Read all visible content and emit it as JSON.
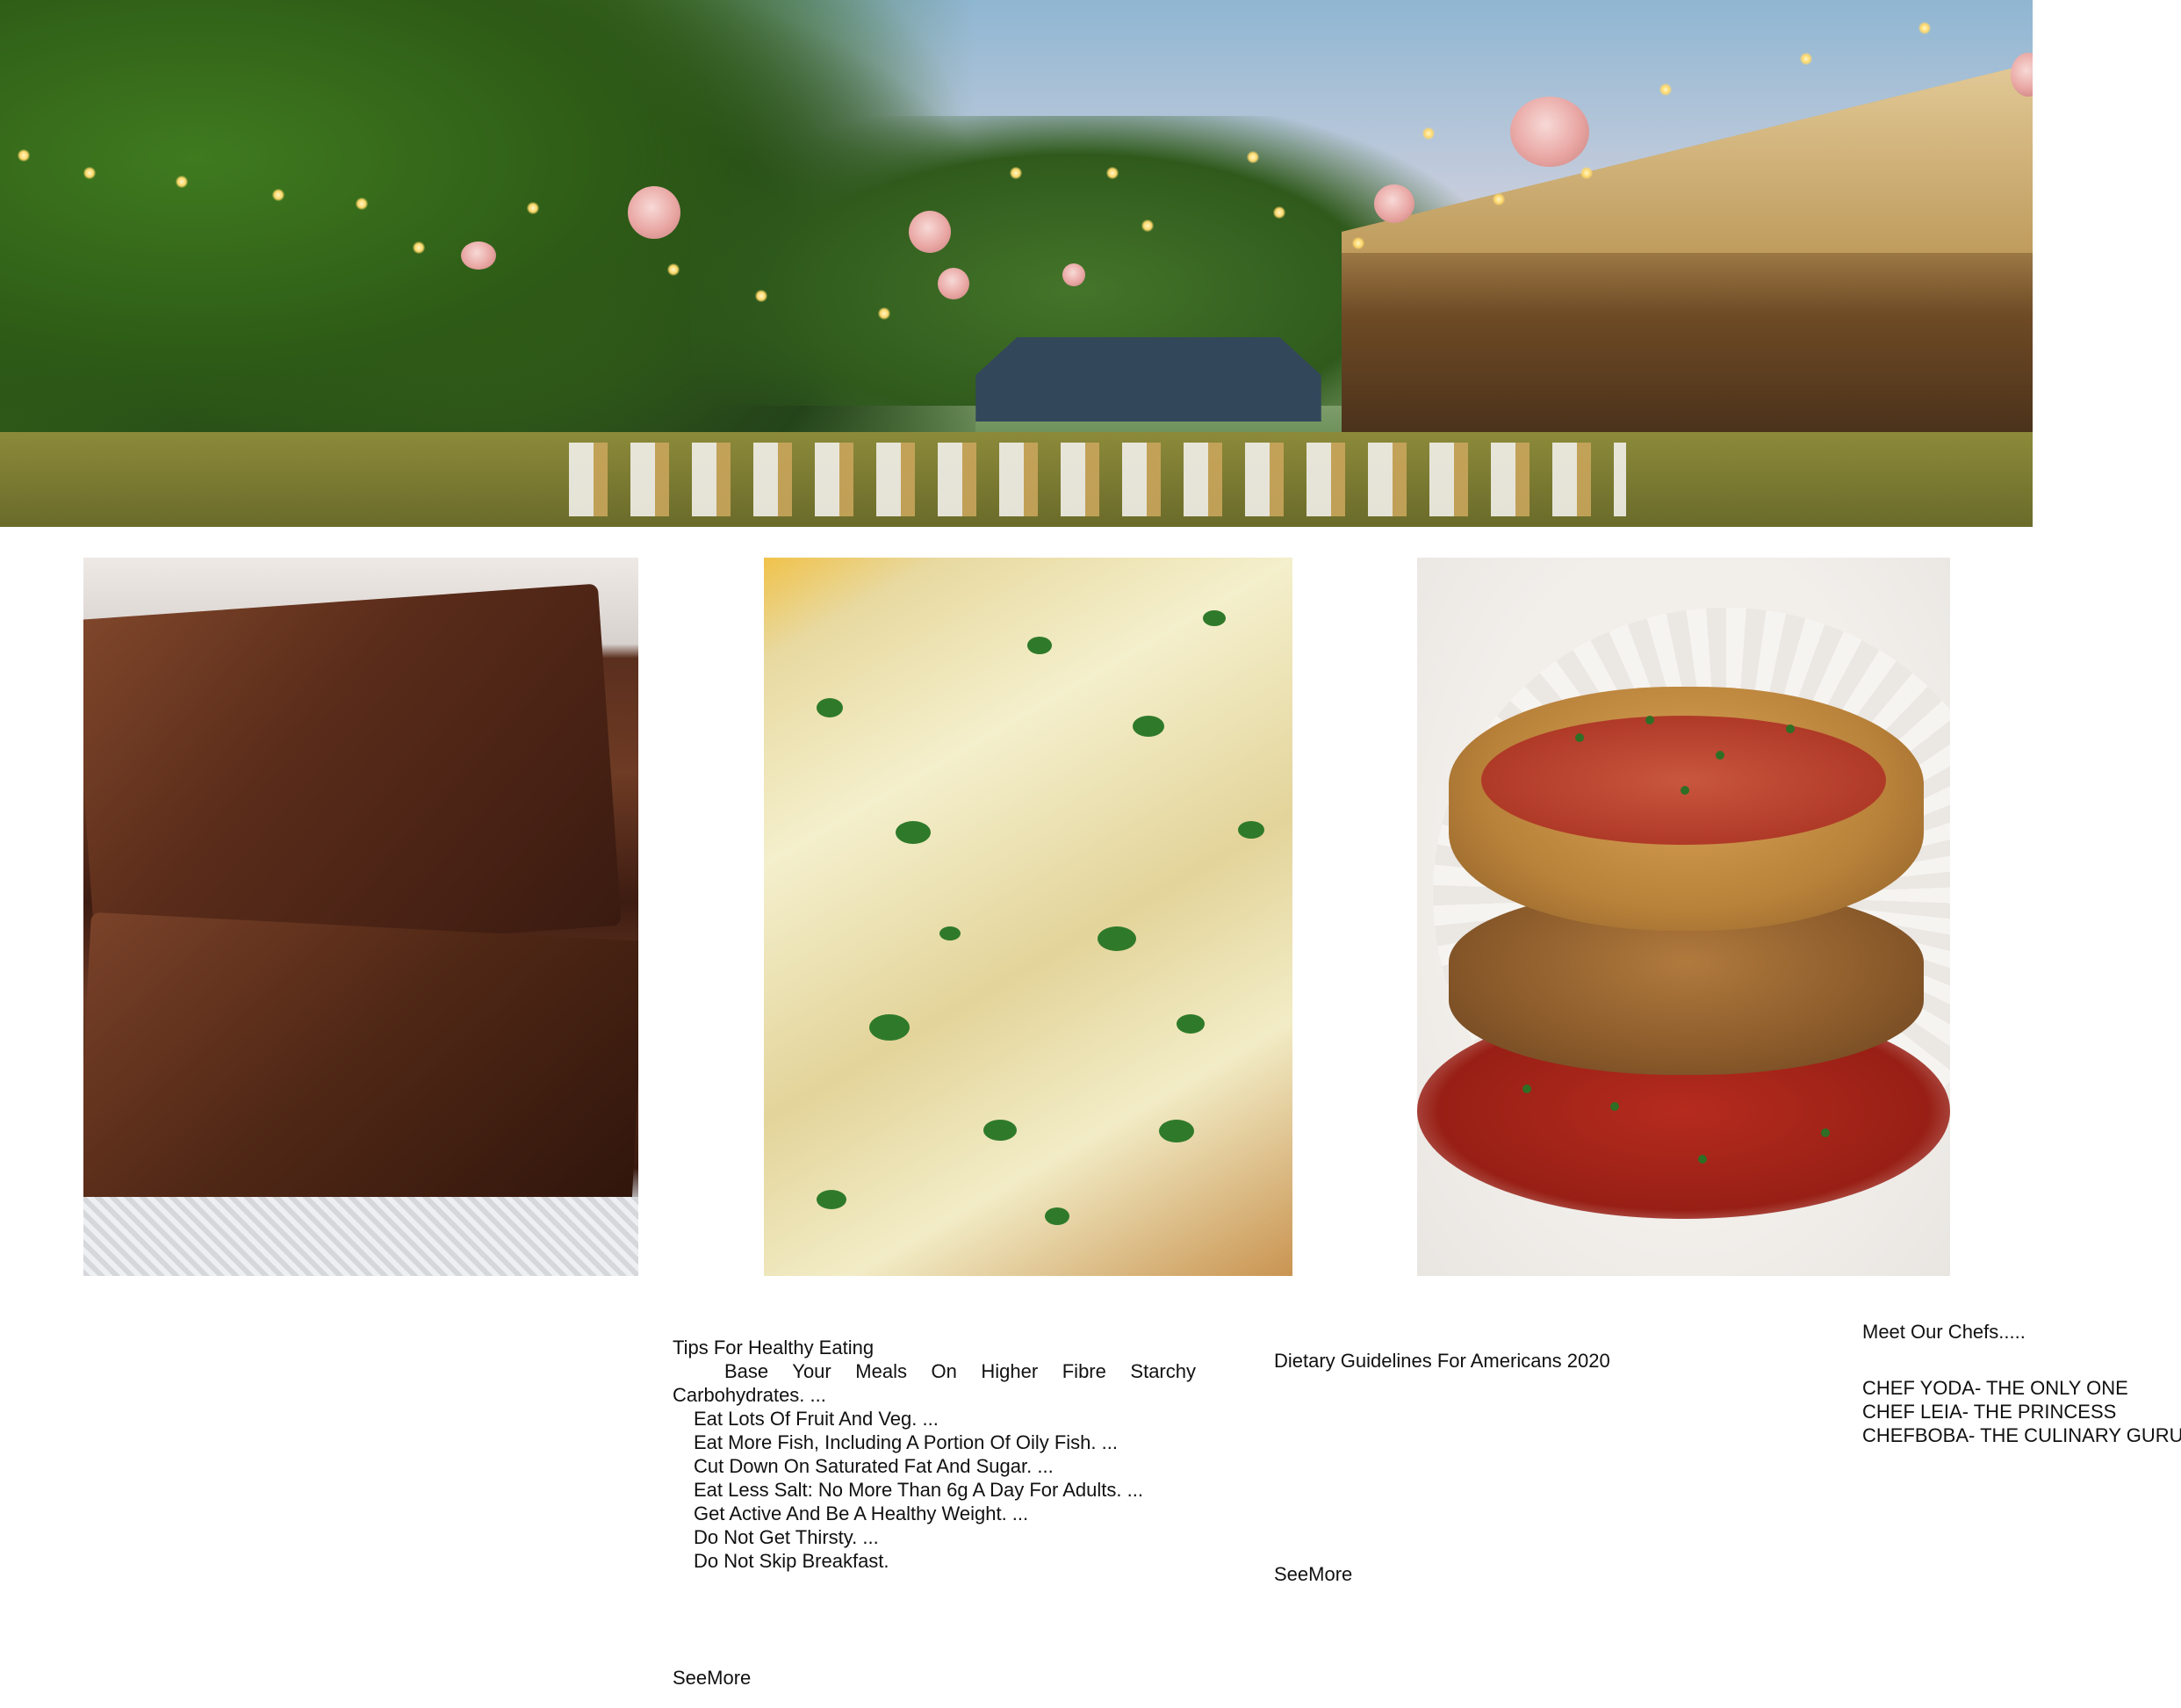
{
  "hero": {
    "alt": "outdoor garden restaurant with string lights"
  },
  "food_images": [
    {
      "name": "brownie"
    },
    {
      "name": "garlic-bread"
    },
    {
      "name": "eggplant-parmesan"
    }
  ],
  "tips": {
    "title": "Tips For Healthy Eating",
    "items": [
      "Base Your Meals On Higher Fibre Starchy Carbohydrates. ...",
      "Eat Lots Of Fruit And Veg. ...",
      "Eat More Fish, Including A Portion Of Oily Fish. ...",
      "Cut Down On Saturated Fat And Sugar. ...",
      "Eat Less Salt: No More Than 6g A Day For Adults. ...",
      "Get Active And Be A Healthy Weight. ...",
      "Do Not Get Thirsty. ...",
      "Do Not Skip Breakfast."
    ],
    "see_more": "SeeMore"
  },
  "dietary": {
    "title": "Dietary Guidelines For Americans 2020",
    "see_more": "SeeMore"
  },
  "chefs": {
    "title": "Meet Our Chefs.....",
    "items": [
      "CHEF YODA- THE ONLY ONE",
      "CHEF LEIA- THE PRINCESS",
      "CHEFBOBA- THE CULINARY GURU"
    ]
  }
}
